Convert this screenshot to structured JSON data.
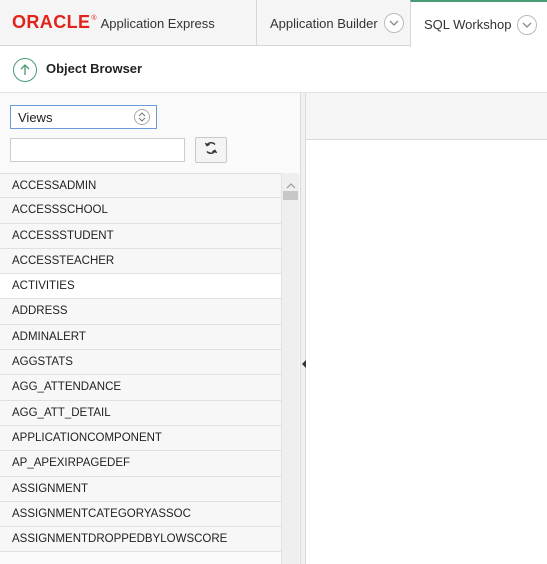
{
  "header": {
    "logo_oracle": "ORACLE",
    "logo_reg": "®",
    "logo_app": "Application Express",
    "tabs": [
      {
        "label": "Application Builder"
      },
      {
        "label": "SQL Workshop"
      }
    ]
  },
  "breadcrumb": {
    "title": "Object Browser"
  },
  "object_browser": {
    "type_select": {
      "value": "Views"
    },
    "search": {
      "value": ""
    },
    "items": [
      "ACCESSADMIN",
      "ACCESSSCHOOL",
      "ACCESSSTUDENT",
      "ACCESSTEACHER",
      "ACTIVITIES",
      "ADDRESS",
      "ADMINALERT",
      "AGGSTATS",
      "AGG_ATTENDANCE",
      "AGG_ATT_DETAIL",
      "APPLICATIONCOMPONENT",
      "AP_APEXIRPAGEDEF",
      "ASSIGNMENT",
      "ASSIGNMENTCATEGORYASSOC",
      "ASSIGNMENTDROPPEDBYLOWSCORE"
    ],
    "selected_item": "ACTIVITIES"
  },
  "colors": {
    "brand_red": "#e2231a",
    "accent_green": "#4a9a74",
    "select_border": "#6a9bd8"
  }
}
